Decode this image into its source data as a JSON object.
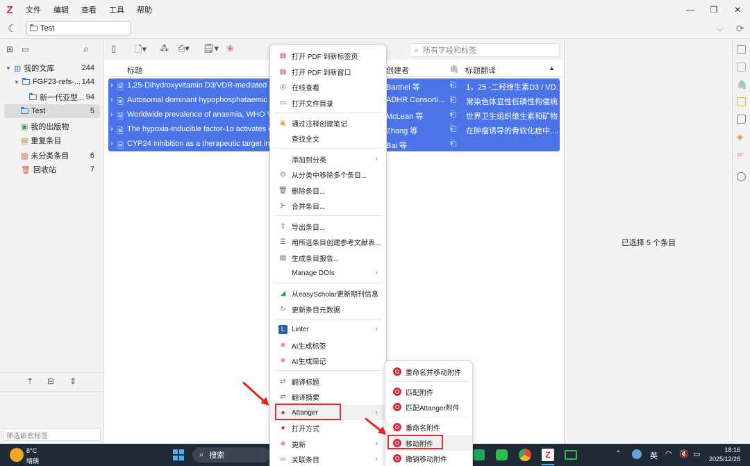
{
  "menubar": {
    "items": [
      "文件",
      "编辑",
      "查看",
      "工具",
      "帮助"
    ]
  },
  "tab": {
    "label": "Test"
  },
  "sidebar": {
    "items": [
      {
        "label": "我的文库",
        "count": "244"
      },
      {
        "label": "FGF23-refs-...",
        "count": "144"
      },
      {
        "label": "新一代亚型...",
        "count": "94"
      },
      {
        "label": "Test",
        "count": "5"
      },
      {
        "label": "我的出版物",
        "count": ""
      },
      {
        "label": "重复条目",
        "count": ""
      },
      {
        "label": "未分类条目",
        "count": "6"
      },
      {
        "label": "回收站",
        "count": "7"
      }
    ],
    "filter_placeholder": "筛选嵌套标签"
  },
  "search": {
    "placeholder": "所有字段和标签"
  },
  "columns": {
    "title": "标题",
    "creator": "创建者",
    "translation": "标题翻译"
  },
  "rows": [
    {
      "title": "1,25-Dihydroxyvitamin D3/VDR-mediated in",
      "creator": "Barthel 等",
      "translation": "1，25 -二羟维生素D3 / VD..."
    },
    {
      "title": "Autosomal dominant hypophosphataemic ri",
      "creator": "ADHR Consorti...",
      "translation": "常染色体显性低磷性佝偻病..."
    },
    {
      "title": "Worldwide prevalence of anaemia, WHO Vit",
      "creator": "McLean 等",
      "translation": "世界卫生组织维生素和矿物..."
    },
    {
      "title": "The hypoxia-inducible factor-1α activates ec",
      "creator": "Zhang 等",
      "translation": "在肿瘤诱导的骨软化症中,..."
    },
    {
      "title": "CYP24 inhibition as a therapeutic target in F",
      "creator": "Bai 等",
      "translation": ""
    }
  ],
  "right_pane": {
    "status": "已选择 5 个条目"
  },
  "context_menu": [
    "打开 PDF 到新标签页",
    "打开 PDF 到新窗口",
    "在线查看",
    "打开文件目录",
    "通过注释创建笔记",
    "查找全文",
    "添加到分类",
    "从分类中移除多个条目...",
    "删除条目...",
    "合并条目...",
    "导出条目...",
    "用所选条目创建参考文献表...",
    "生成条目报告...",
    "Manage DOIs",
    "从easyScholar更新期刊信息",
    "更新条目元数据",
    "Linter",
    "AI生成标签",
    "AI生成简记",
    "翻译标题",
    "翻译摘要",
    "Attanger",
    "打开方式",
    "更新",
    "关联条目"
  ],
  "submenu": [
    "重命名并移动附件",
    "匹配附件",
    "匹配Attanger附件",
    "重命名附件",
    "移动附件",
    "撤销移动附件"
  ],
  "taskbar": {
    "temp": "8°C",
    "weather": "晴朗",
    "search": "搜索",
    "lang": "英",
    "time": "18:16",
    "date": "2025/12/28"
  },
  "colors": {
    "selection": "#4a74e8",
    "accent_red": "#e23030",
    "folder_blue": "#3d7dd8"
  }
}
